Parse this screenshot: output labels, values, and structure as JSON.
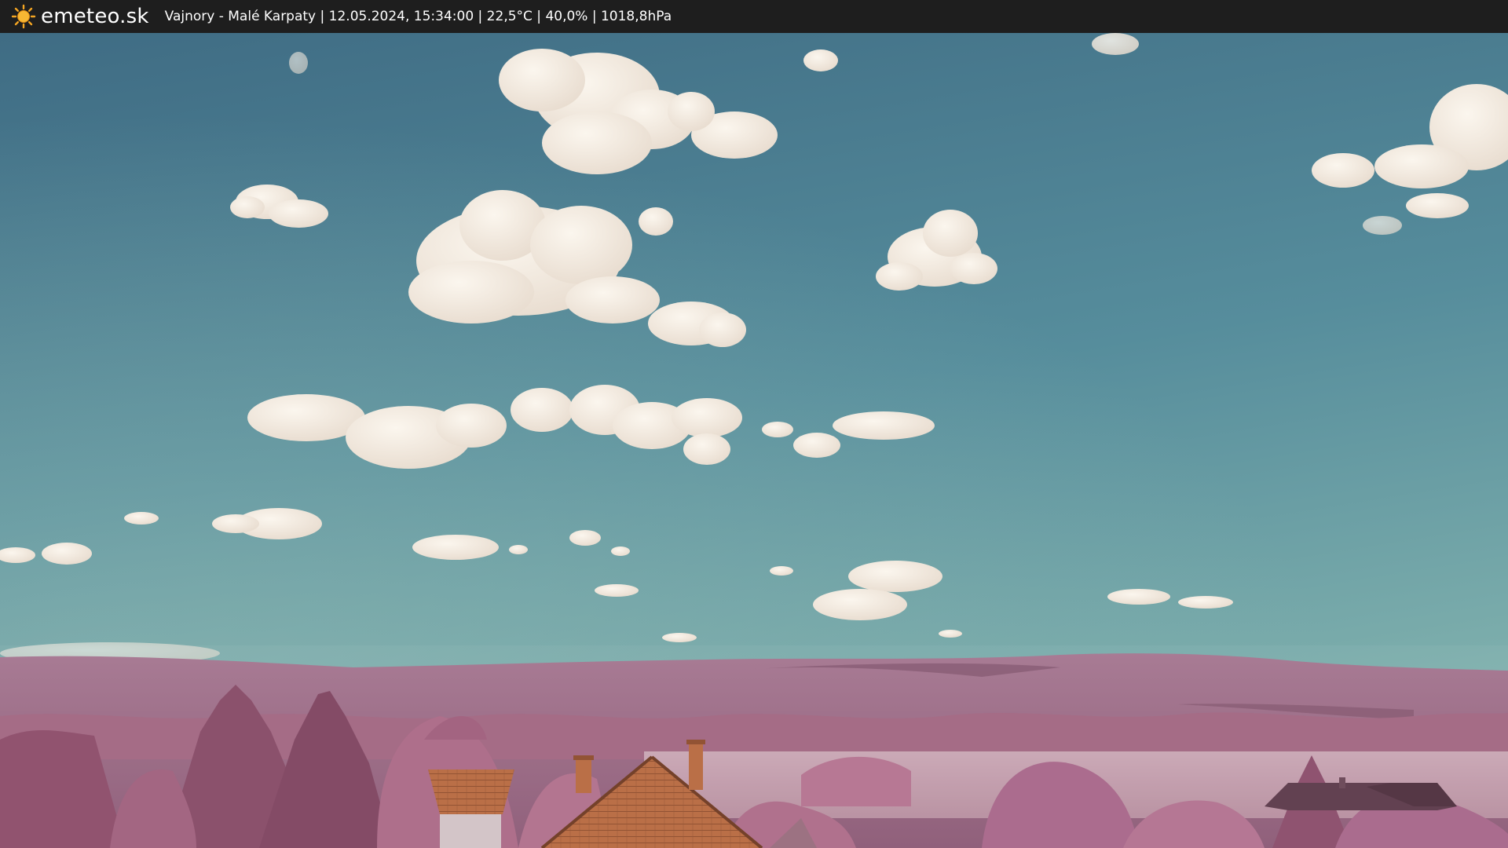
{
  "header": {
    "brand": "emeteo.sk",
    "logo_icon": "sun-icon",
    "info_text": "Vajnory - Malé Karpaty | 12.05.2024, 15:34:00 | 22,5°C | 40,0% | 1018,8hPa"
  },
  "colors": {
    "header_bg": "#1e1e1e",
    "sun": "#f5a623",
    "sky_top": "#3f6f86",
    "sky_bottom": "#6fa4ab",
    "cloud": "#f4ece1",
    "hills": "#9c6a85",
    "foliage": "#a8607e",
    "roof": "#b8683e"
  }
}
